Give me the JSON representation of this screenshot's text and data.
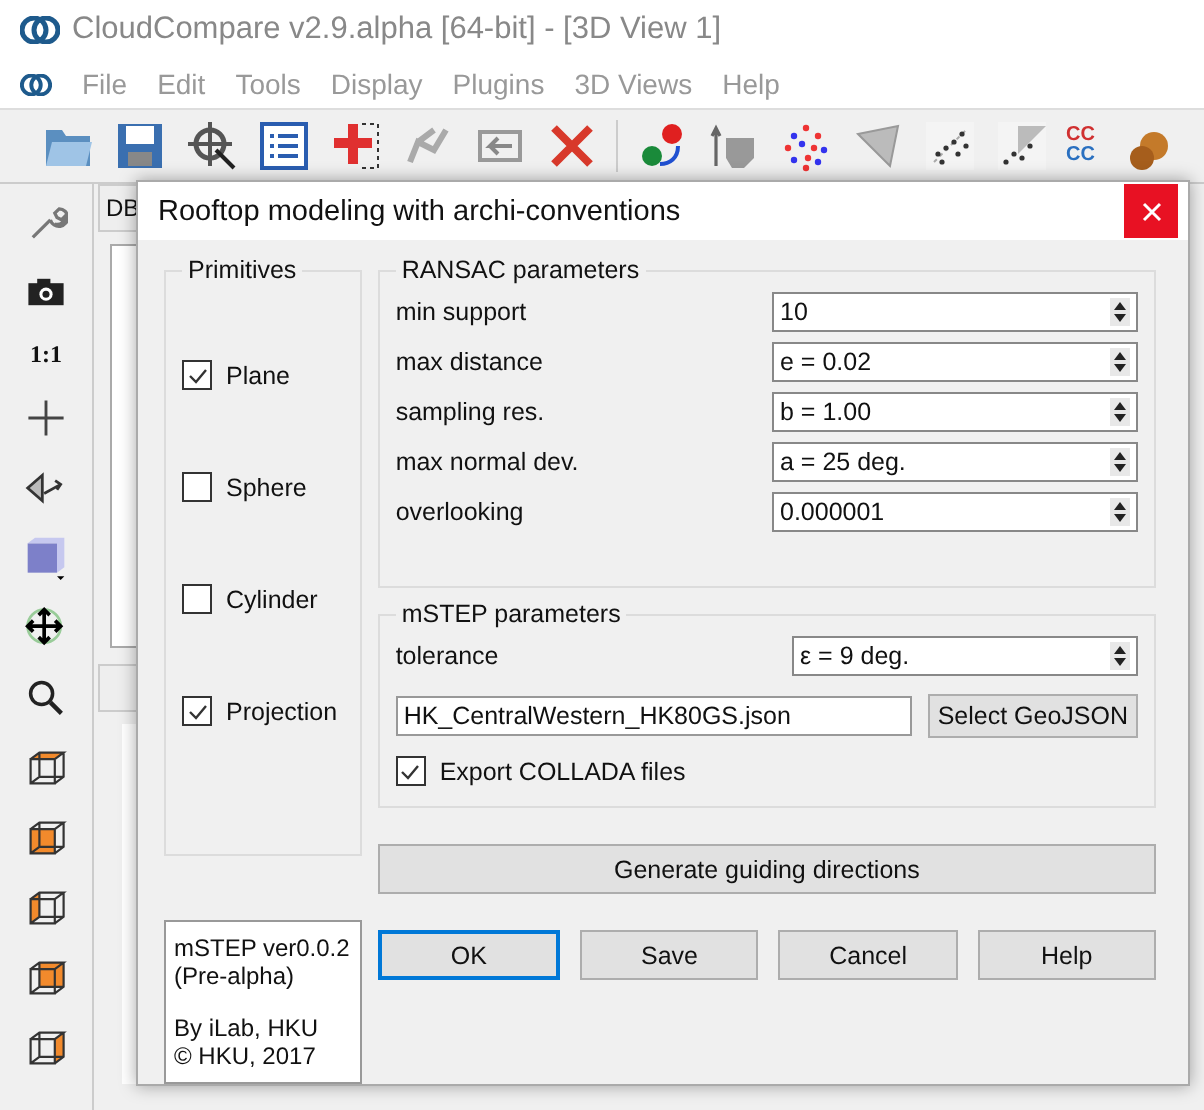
{
  "window": {
    "title": "CloudCompare v2.9.alpha [64-bit] - [3D View 1]"
  },
  "menu": [
    "File",
    "Edit",
    "Tools",
    "Display",
    "Plugins",
    "3D Views",
    "Help"
  ],
  "toolbar": {
    "logo_letters": [
      "CC",
      "CC"
    ]
  },
  "side_toolbar": {
    "zoom_label": "1:1"
  },
  "background_panels": {
    "db_tab": "DB"
  },
  "dialog": {
    "title": "Rooftop modeling with archi-conventions",
    "primitives": {
      "title": "Primitives",
      "items": [
        {
          "label": "Plane",
          "checked": true
        },
        {
          "label": "Sphere",
          "checked": false
        },
        {
          "label": "Cylinder",
          "checked": false
        },
        {
          "label": "Projection",
          "checked": true
        }
      ]
    },
    "ransac": {
      "title": "RANSAC parameters",
      "rows": [
        {
          "label": "min support",
          "value": "10"
        },
        {
          "label": "max distance",
          "value": "e = 0.02"
        },
        {
          "label": "sampling res.",
          "value": "b = 1.00"
        },
        {
          "label": "max normal dev.",
          "value": "a = 25 deg."
        },
        {
          "label": "overlooking",
          "value": "0.000001"
        }
      ]
    },
    "mstep": {
      "title": "mSTEP parameters",
      "tolerance_label": "tolerance",
      "tolerance_value": "ε = 9 deg.",
      "file": "HK_CentralWestern_HK80GS.json",
      "select_button": "Select GeoJSON",
      "export": {
        "label": "Export COLLADA files",
        "checked": true
      }
    },
    "info": [
      "mSTEP ver0.0.2",
      "(Pre-alpha)",
      "By iLab, HKU",
      "© HKU, 2017"
    ],
    "generate_button": "Generate guiding directions",
    "buttons": [
      {
        "label": "OK",
        "selected": true
      },
      {
        "label": "Save",
        "selected": false
      },
      {
        "label": "Cancel",
        "selected": false
      },
      {
        "label": "Help",
        "selected": false
      }
    ]
  }
}
